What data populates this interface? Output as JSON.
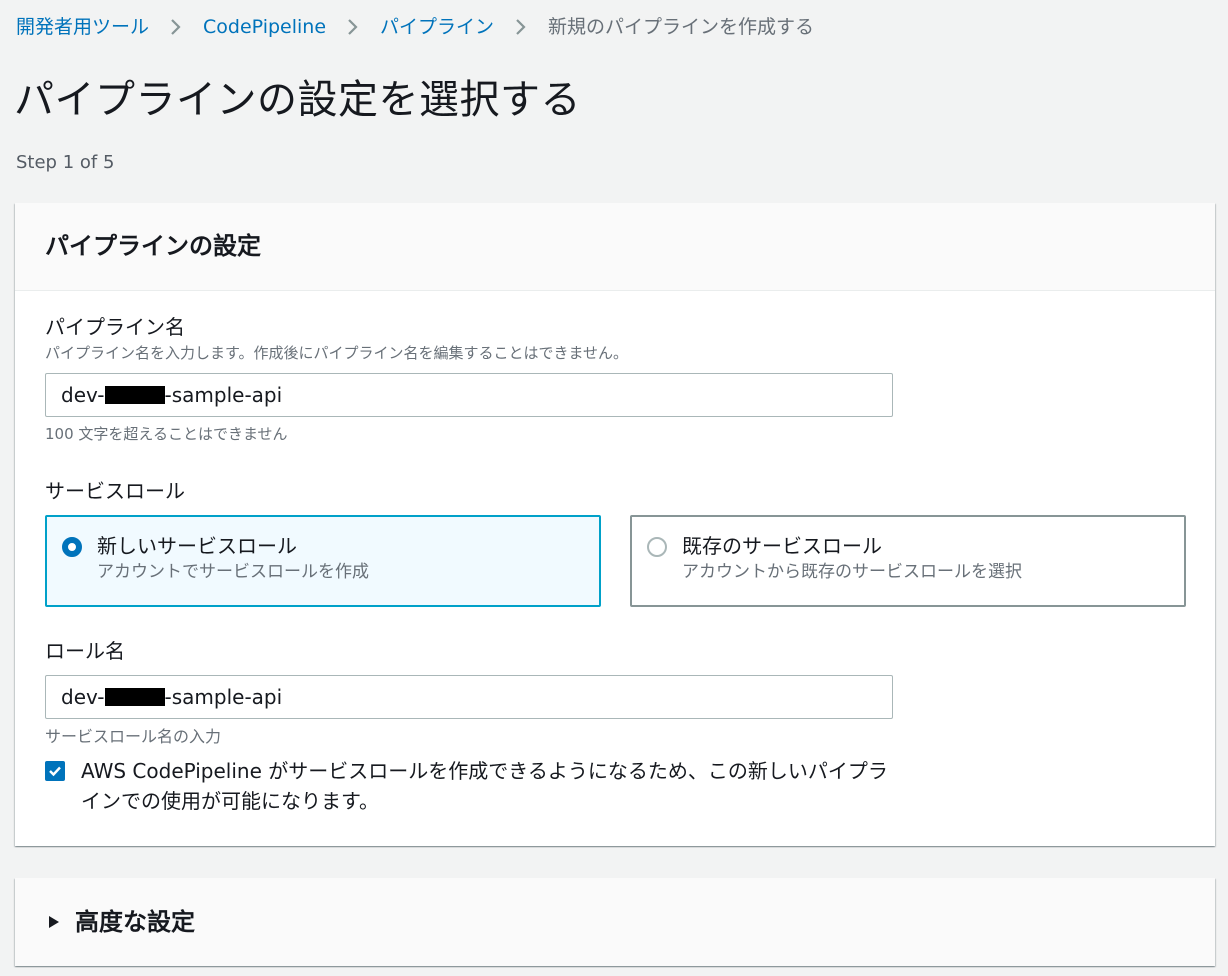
{
  "breadcrumb": {
    "items": [
      "開発者用ツール",
      "CodePipeline",
      "パイプライン"
    ],
    "current": "新規のパイプラインを作成する"
  },
  "page": {
    "title": "パイプラインの設定を選択する",
    "step": "Step 1 of 5"
  },
  "pipeline_settings": {
    "title": "パイプラインの設定",
    "name_label": "パイプライン名",
    "name_description": "パイプライン名を入力します。作成後にパイプライン名を編集することはできません。",
    "name_value_prefix": "dev-",
    "name_value_suffix": "-sample-api",
    "name_constraint": "100 文字を超えることはできません",
    "service_role_label": "サービスロール",
    "role_options": [
      {
        "title": "新しいサービスロール",
        "description": "アカウントでサービスロールを作成",
        "selected": true
      },
      {
        "title": "既存のサービスロール",
        "description": "アカウントから既存のサービスロールを選択",
        "selected": false
      }
    ],
    "role_name_label": "ロール名",
    "role_name_prefix": "dev-",
    "role_name_suffix": "-sample-api",
    "role_name_description": "サービスロール名の入力",
    "allow_checkbox_label": "AWS CodePipeline がサービスロールを作成できるようになるため、この新しいパイプラインでの使用が可能になります。",
    "allow_checkbox_checked": true
  },
  "advanced": {
    "title": "高度な設定"
  },
  "colors": {
    "link": "#0073bb",
    "selected_border": "#00a1c9",
    "selected_bg": "#f1faff"
  }
}
